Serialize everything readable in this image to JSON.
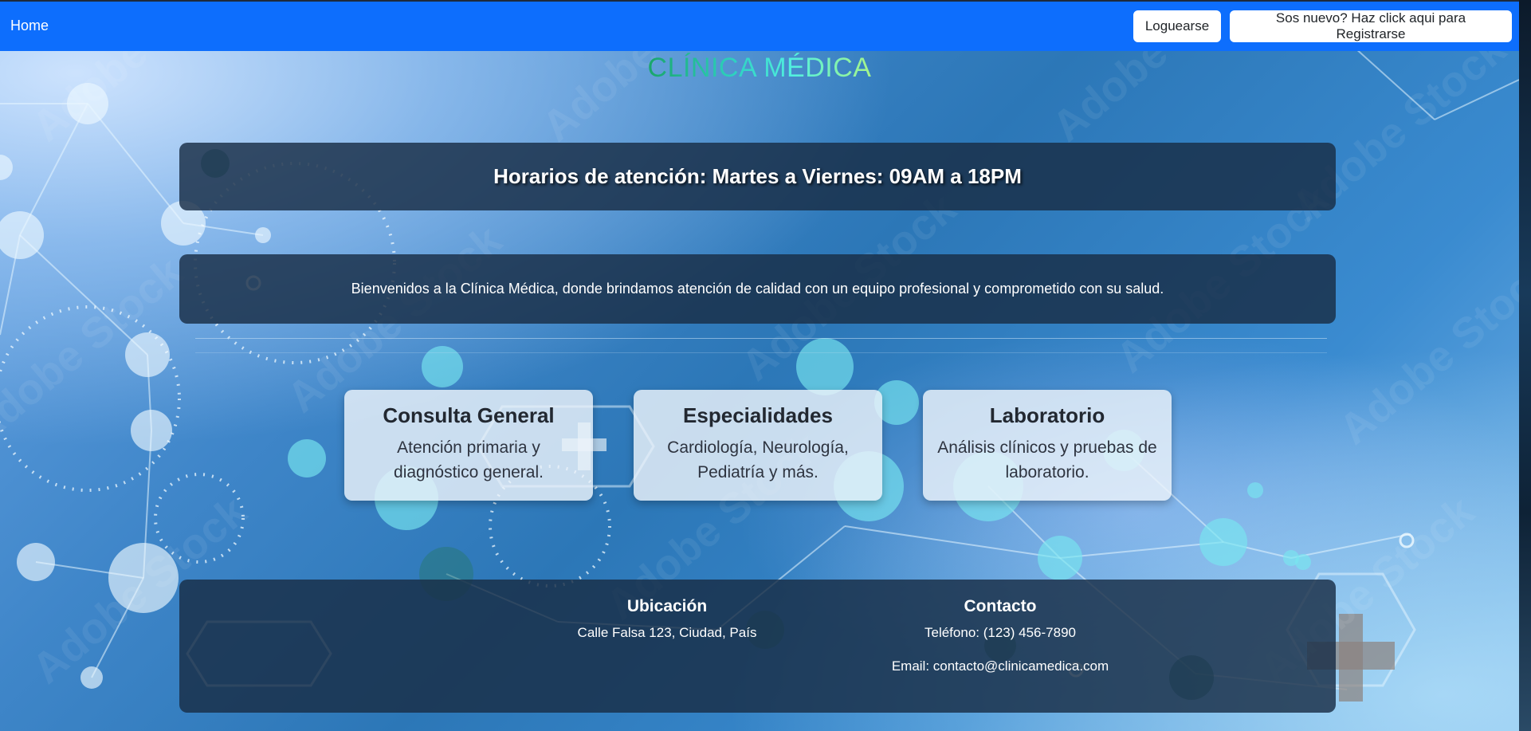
{
  "navbar": {
    "home_label": "Home",
    "login_label": "Loguearse",
    "register_label": "Sos nuevo? Haz click aqui para Registrarse",
    "color": "#0d6efd"
  },
  "header": {
    "title": "CLÍNICA MÉDICA"
  },
  "hours": {
    "text": "Horarios de atención: Martes a Viernes: 09AM a 18PM"
  },
  "welcome": {
    "text": "Bienvenidos a la Clínica Médica, donde brindamos atención de calidad con un equipo profesional y comprometido con su salud."
  },
  "services": [
    {
      "title": "Consulta General",
      "description": "Atención primaria y diagnóstico general."
    },
    {
      "title": "Especialidades",
      "description": "Cardiología, Neurología, Pediatría y más."
    },
    {
      "title": "Laboratorio",
      "description": "Análisis clínicos y pruebas de laboratorio."
    }
  ],
  "footer": {
    "location_heading": "Ubicación",
    "location_address": "Calle Falsa 123, Ciudad, País",
    "contact_heading": "Contacto",
    "contact_phone": "Teléfono: (123) 456-7890",
    "contact_email": "Email: contacto@clinicamedica.com"
  }
}
